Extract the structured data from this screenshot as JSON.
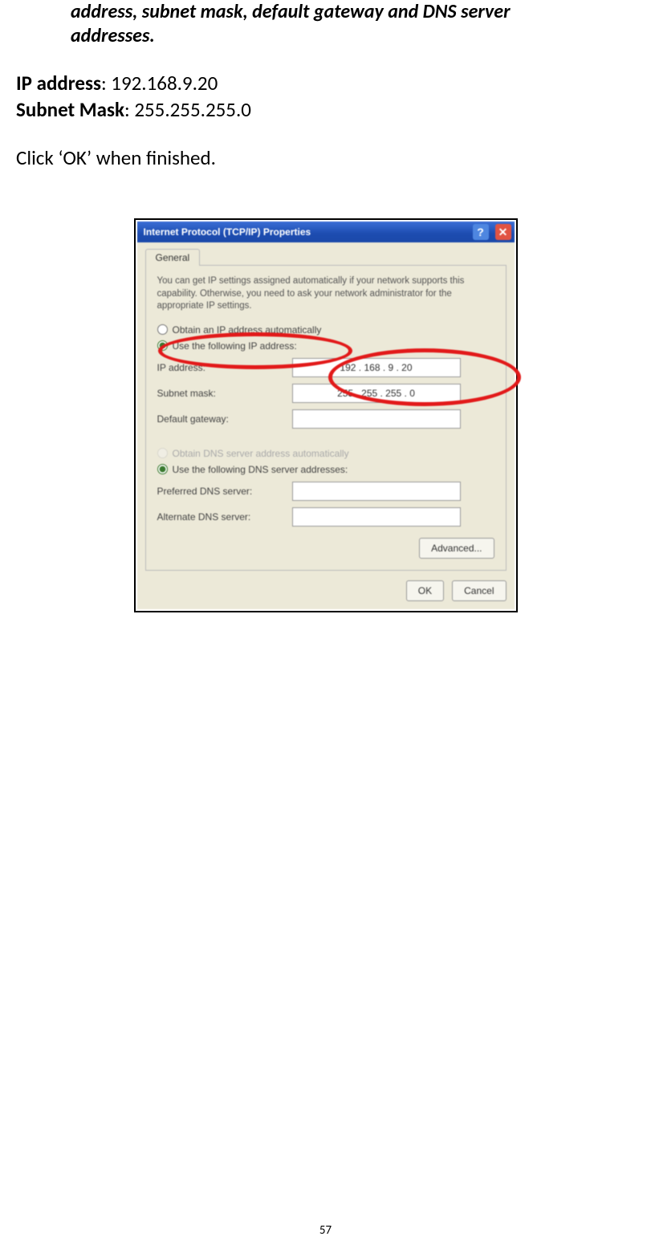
{
  "doc": {
    "intro_italic": "address, subnet mask, default gateway and DNS server addresses.",
    "ip_label": "IP address",
    "ip_value": "192.168.9.20",
    "mask_label": "Subnet Mask",
    "mask_value": "255.255.255.0",
    "click_ok": "Click ‘OK’ when finished.",
    "page_number": "57"
  },
  "dialog": {
    "title": "Internet Protocol (TCP/IP) Properties",
    "tab_general": "General",
    "description": "You can get IP settings assigned automatically if your network supports this capability. Otherwise, you need to ask your network administrator for the appropriate IP settings.",
    "radio_auto_ip": "Obtain an IP address automatically",
    "radio_use_ip": "Use the following IP address:",
    "label_ip": "IP address:",
    "label_mask": "Subnet mask:",
    "label_gateway": "Default gateway:",
    "value_ip": "192 . 168 .  9  . 20",
    "value_mask": "255 . 255 . 255 .  0",
    "radio_auto_dns": "Obtain DNS server address automatically",
    "radio_use_dns": "Use the following DNS server addresses:",
    "label_pref_dns": "Preferred DNS server:",
    "label_alt_dns": "Alternate DNS server:",
    "btn_advanced": "Advanced...",
    "btn_ok": "OK",
    "btn_cancel": "Cancel"
  }
}
